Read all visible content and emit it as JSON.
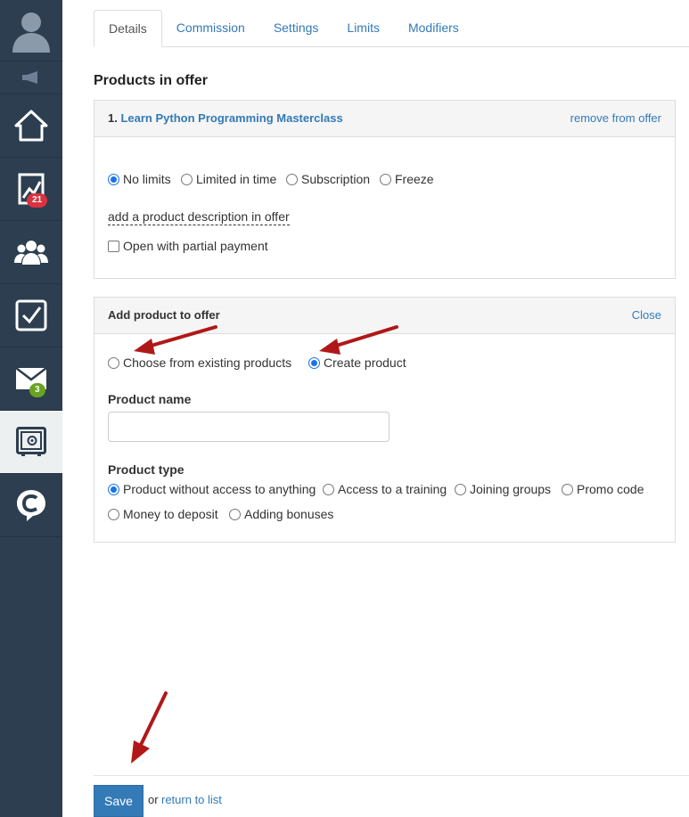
{
  "sidebar": {
    "items": [
      {
        "name": "avatar-icon"
      },
      {
        "name": "megaphone-icon"
      },
      {
        "name": "home-icon"
      },
      {
        "name": "chart-icon",
        "badge": "21",
        "badge_color": "#d9333f"
      },
      {
        "name": "users-icon"
      },
      {
        "name": "tasks-checkbox-icon"
      },
      {
        "name": "mail-icon",
        "badge": "3",
        "badge_color": "#6aa322"
      },
      {
        "name": "safe-icon",
        "active": true
      },
      {
        "name": "chat-c-icon"
      }
    ]
  },
  "tabs": [
    "Details",
    "Commission",
    "Settings",
    "Limits",
    "Modifiers"
  ],
  "active_tab": "Details",
  "products_heading": "Products in offer",
  "product_panel": {
    "number": "1.",
    "product_name": "Learn Python Programming Masterclass",
    "remove_label": "remove from offer",
    "access_options": [
      "No limits",
      "Limited in time",
      "Subscription",
      "Freeze"
    ],
    "access_selected": "No limits",
    "description_link": "add a product description in offer",
    "partial_payment_label": "Open with partial payment",
    "partial_payment_checked": false
  },
  "add_panel": {
    "title": "Add product to offer",
    "close_label": "Close",
    "source_options": [
      "Choose from existing products",
      "Create product"
    ],
    "source_selected": "Create product",
    "product_name_label": "Product name",
    "product_name_value": "",
    "product_type_label": "Product type",
    "product_types": [
      "Product without access to anything",
      "Access to a training",
      "Joining groups",
      "Promo code",
      "Money to deposit",
      "Adding bonuses"
    ],
    "product_type_selected": "Product without access to anything"
  },
  "footer": {
    "save_label": "Save",
    "or_text": "or",
    "return_label": "return to list"
  },
  "colors": {
    "sidebar": "#2c3e50",
    "link": "#337ab7",
    "primary": "#337ab7",
    "arrow": "#b01818"
  }
}
